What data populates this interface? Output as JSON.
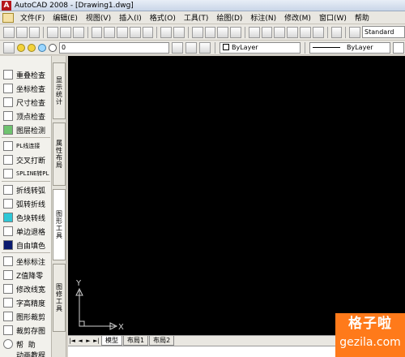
{
  "window": {
    "title": "AutoCAD 2008 - [Drawing1.dwg]",
    "app_icon_letter": "A"
  },
  "menu": [
    "文件(F)",
    "编辑(E)",
    "视图(V)",
    "插入(I)",
    "格式(O)",
    "工具(T)",
    "绘图(D)",
    "标注(N)",
    "修改(M)",
    "窗口(W)",
    "帮助"
  ],
  "toolbar": {
    "text_style": "Standard"
  },
  "layer": {
    "current": "0"
  },
  "properties": {
    "color": "ByLayer",
    "linetype": "ByLayer"
  },
  "sidebar_items": [
    {
      "label": "重叠检查",
      "icon": "overlap-check-icon"
    },
    {
      "label": "坐标检查",
      "icon": "coord-check-icon"
    },
    {
      "label": "尺寸检查",
      "icon": "dim-check-icon"
    },
    {
      "label": "顶点检查",
      "icon": "vertex-check-icon"
    },
    {
      "label": "图层检测",
      "icon": "layer-check-icon"
    },
    {
      "label": "PL线连接",
      "icon": "pline-join-icon"
    },
    {
      "label": "交叉打断",
      "icon": "cross-break-icon"
    },
    {
      "label": "SPLINE转PL",
      "icon": "spline-convert-icon"
    },
    {
      "label": "折线转弧",
      "icon": "polyline-arc-icon"
    },
    {
      "label": "弧转折线",
      "icon": "arc-polyline-icon"
    },
    {
      "label": "色块转线",
      "icon": "color-block-icon"
    },
    {
      "label": "单边退格",
      "icon": "edge-offset-icon"
    },
    {
      "label": "自由填色",
      "icon": "fill-color-icon"
    },
    {
      "label": "坐标标注",
      "icon": "coord-dim-icon"
    },
    {
      "label": "Z值降零",
      "icon": "z-zero-icon"
    },
    {
      "label": "修改线宽",
      "icon": "lineweight-icon"
    },
    {
      "label": "字高精度",
      "icon": "text-height-icon"
    },
    {
      "label": "图形裁剪",
      "icon": "clip-icon"
    },
    {
      "label": "裁剪存图",
      "icon": "clip-save-icon"
    },
    {
      "label": "帮  助",
      "icon": "help-icon"
    },
    {
      "label": "动画教程",
      "icon": "tutorial-icon"
    }
  ],
  "vertical_tabs": [
    "显示统计",
    "属性布局",
    "图形工具",
    "图修工具"
  ],
  "canvas": {
    "ucs_x": "X",
    "ucs_y": "Y",
    "background": "#000000"
  },
  "layout_tabs": [
    "模型",
    "布局1",
    "布局2"
  ],
  "watermark": {
    "cn": "格子啦",
    "en": "gezila.com"
  }
}
